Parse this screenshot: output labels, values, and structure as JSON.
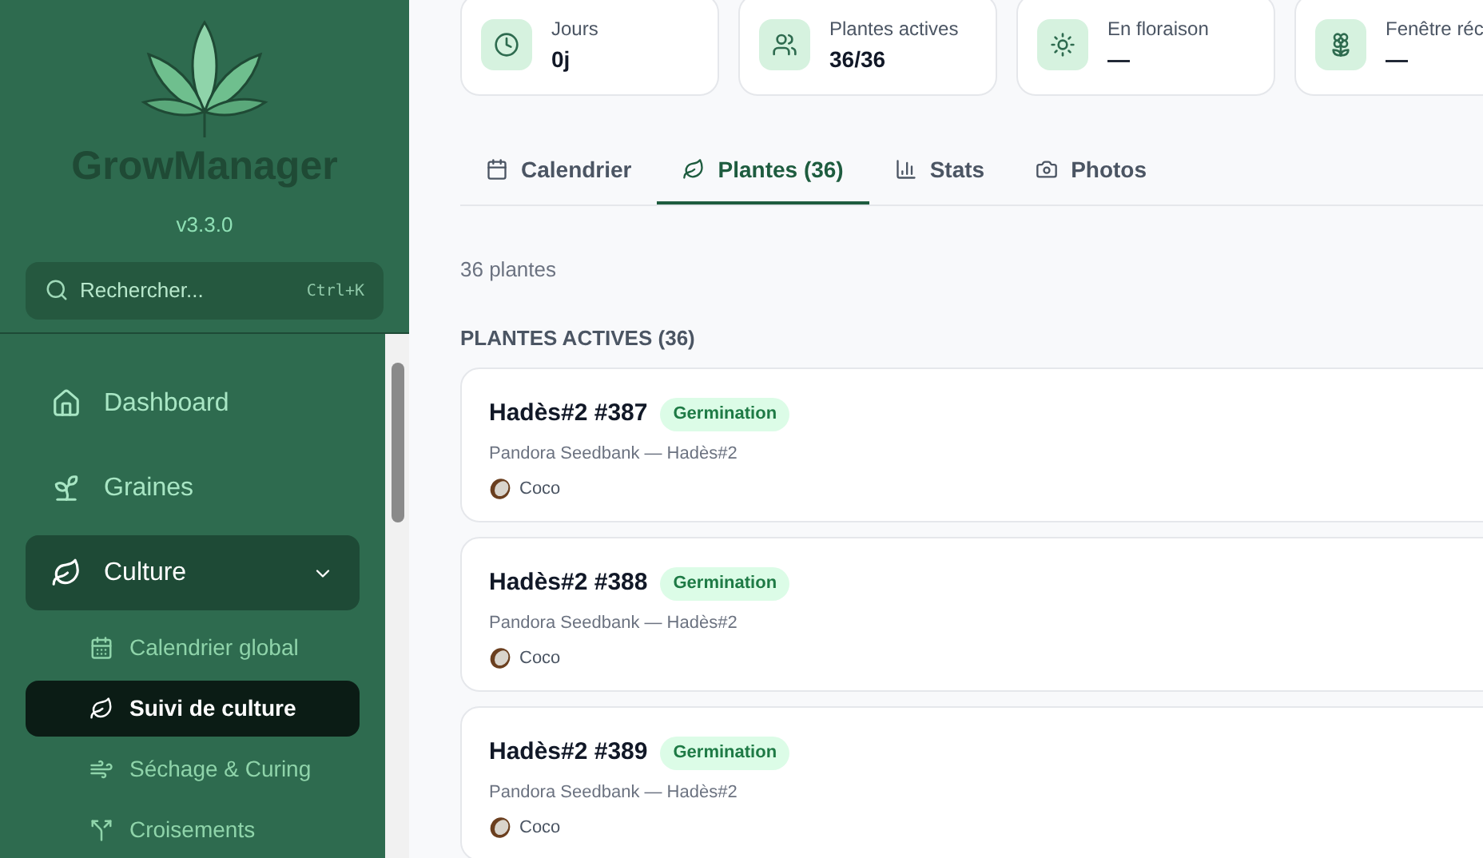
{
  "sidebar": {
    "app_name": "GrowManager",
    "version": "v3.3.0",
    "search": {
      "placeholder": "Rechercher...",
      "shortcut": "Ctrl+K"
    },
    "nav": [
      {
        "label": "Dashboard",
        "selected": false
      },
      {
        "label": "Graines",
        "selected": false
      },
      {
        "label": "Culture",
        "selected": true,
        "expanded": true,
        "children": [
          {
            "label": "Calendrier global",
            "selected": false
          },
          {
            "label": "Suivi de culture",
            "selected": true
          },
          {
            "label": "Séchage & Curing",
            "selected": false
          },
          {
            "label": "Croisements",
            "selected": false
          }
        ]
      }
    ]
  },
  "stats": [
    {
      "label": "Jours",
      "value": "0j"
    },
    {
      "label": "Plantes actives",
      "value": "36/36"
    },
    {
      "label": "En floraison",
      "value": "—"
    },
    {
      "label": "Fenêtre réc",
      "value": "—"
    }
  ],
  "tabs": [
    {
      "label": "Calendrier",
      "selected": false
    },
    {
      "label": "Plantes (36)",
      "selected": true
    },
    {
      "label": "Stats",
      "selected": false
    },
    {
      "label": "Photos",
      "selected": false
    }
  ],
  "count": "36 plantes",
  "section_title": "PLANTES ACTIVES (36)",
  "plants": [
    {
      "name": "Hadès#2 #387",
      "stage": "Germination",
      "origin": "Pandora Seedbank — Hadès#2",
      "medium": "Coco"
    },
    {
      "name": "Hadès#2 #388",
      "stage": "Germination",
      "origin": "Pandora Seedbank — Hadès#2",
      "medium": "Coco"
    },
    {
      "name": "Hadès#2 #389",
      "stage": "Germination",
      "origin": "Pandora Seedbank — Hadès#2",
      "medium": "Coco"
    }
  ]
}
